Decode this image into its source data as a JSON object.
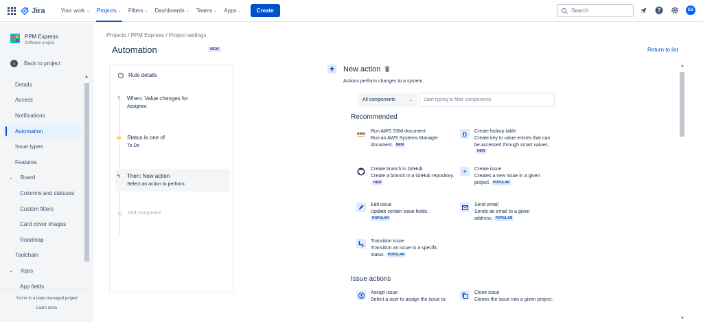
{
  "topnav": {
    "logo": "Jira",
    "items": [
      {
        "label": "Your work"
      },
      {
        "label": "Projects"
      },
      {
        "label": "Filters"
      },
      {
        "label": "Dashboards"
      },
      {
        "label": "Teams"
      },
      {
        "label": "Apps"
      }
    ],
    "active_item": "Projects",
    "create_label": "Create",
    "search_placeholder": "Search",
    "avatar_initials": "ES",
    "accent": "#0052cc"
  },
  "sidebar": {
    "project_name": "PPM Express",
    "project_type": "Software project",
    "back_label": "Back to project",
    "items": [
      {
        "label": "Details"
      },
      {
        "label": "Access"
      },
      {
        "label": "Notifications"
      },
      {
        "label": "Automation"
      },
      {
        "label": "Issue types"
      },
      {
        "label": "Features"
      },
      {
        "label": "Board"
      },
      {
        "label": "Columns and statuses"
      },
      {
        "label": "Custom filters"
      },
      {
        "label": "Card cover images"
      },
      {
        "label": "Roadmap"
      },
      {
        "label": "Toolchain"
      },
      {
        "label": "Apps"
      },
      {
        "label": "App fields"
      }
    ],
    "active_item": "Automation",
    "footer_text": "You're in a team-managed project",
    "footer_link": "Learn more"
  },
  "header": {
    "breadcrumb": "Projects / PPM Express / Project settings",
    "title": "Automation",
    "title_badge": "NEW",
    "return_link": "Return to list"
  },
  "rule": {
    "details_label": "Rule details",
    "steps": [
      {
        "title": "When: Value changes for",
        "sub": "Assignee"
      },
      {
        "title": "Status is one of",
        "sub": "To Do"
      },
      {
        "title": "Then: New action",
        "sub": "Select an action to perform."
      }
    ],
    "add_component": "Add component"
  },
  "action": {
    "title": "New action",
    "description": "Actions perform changes to a system.",
    "filter_select": "All components",
    "filter_placeholder": "Start typing to filter components",
    "recommended_heading": "Recommended",
    "recommended": [
      {
        "name": "Run AWS SSM document",
        "desc": "Run an AWS Systems Manager document.",
        "badge": "NEW",
        "icon": "aws-icon"
      },
      {
        "name": "Create lookup table",
        "desc": "Create key to value entries that can be accessed through smart values.",
        "badge": "NEW",
        "icon": "braces-icon"
      },
      {
        "name": "Create branch in GitHub",
        "desc": "Create a branch in a GitHub repository.",
        "badge": "NEW",
        "icon": "github-icon"
      },
      {
        "name": "Create issue",
        "desc": "Creates a new issue in a given project.",
        "badge": "POPULAR",
        "icon": "plus-icon"
      },
      {
        "name": "Edit issue",
        "desc": "Update certain issue fields.",
        "badge": "POPULAR",
        "icon": "pencil-icon"
      },
      {
        "name": "Send email",
        "desc": "Sends an email to a given address.",
        "badge": "POPULAR",
        "icon": "email-icon"
      },
      {
        "name": "Transition issue",
        "desc": "Transition an issue to a specific status.",
        "badge": "POPULAR",
        "icon": "transition-icon"
      }
    ],
    "issue_actions_heading": "Issue actions",
    "issue_actions": [
      {
        "name": "Assign issue",
        "desc": "Select a user to assign the issue to.",
        "icon": "assign-icon"
      },
      {
        "name": "Clone issue",
        "desc": "Clones the issue into a given project.",
        "icon": "clone-icon"
      }
    ]
  }
}
